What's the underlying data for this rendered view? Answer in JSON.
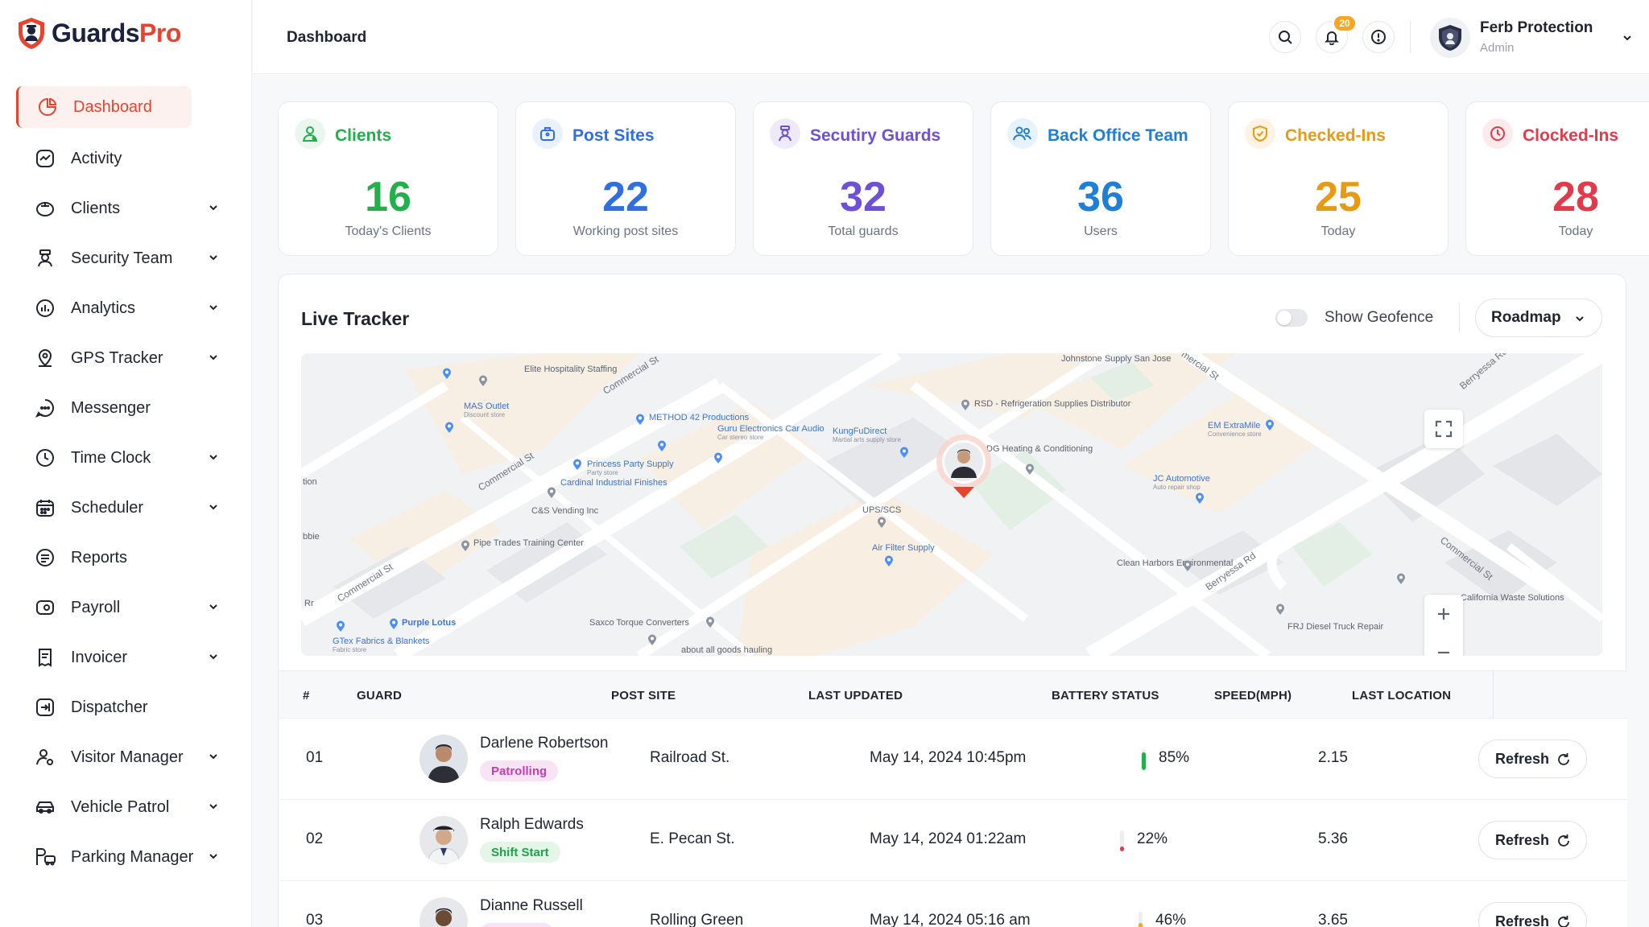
{
  "app": {
    "brand_part1": "Guards",
    "brand_part2": "Pro"
  },
  "header": {
    "title": "Dashboard",
    "notification_count": "20",
    "user_name": "Ferb Protection",
    "user_role": "Admin"
  },
  "sidebar": {
    "items": [
      {
        "label": "Dashboard",
        "icon": "dashboard-icon"
      },
      {
        "label": "Activity",
        "icon": "activity-icon"
      },
      {
        "label": "Clients",
        "icon": "clients-icon"
      },
      {
        "label": "Security Team",
        "icon": "security-team-icon"
      },
      {
        "label": "Analytics",
        "icon": "analytics-icon"
      },
      {
        "label": "GPS Tracker",
        "icon": "gps-tracker-icon"
      },
      {
        "label": "Messenger",
        "icon": "messenger-icon"
      },
      {
        "label": "Time Clock",
        "icon": "time-clock-icon"
      },
      {
        "label": "Scheduler",
        "icon": "scheduler-icon"
      },
      {
        "label": "Reports",
        "icon": "reports-icon"
      },
      {
        "label": "Payroll",
        "icon": "payroll-icon"
      },
      {
        "label": "Invoicer",
        "icon": "invoicer-icon"
      },
      {
        "label": "Dispatcher",
        "icon": "dispatcher-icon"
      },
      {
        "label": "Visitor Manager",
        "icon": "visitor-manager-icon"
      },
      {
        "label": "Vehicle Patrol",
        "icon": "vehicle-patrol-icon"
      },
      {
        "label": "Parking Manager",
        "icon": "parking-manager-icon"
      }
    ]
  },
  "stats": [
    {
      "title": "Clients",
      "value": "16",
      "subtitle": "Today's Clients",
      "color": "#22b04b",
      "bg": "#e9f7ee"
    },
    {
      "title": "Post Sites",
      "value": "22",
      "subtitle": "Working post sites",
      "color": "#2f6fe0",
      "bg": "#eaf1fd"
    },
    {
      "title": "Secutiry Guards",
      "value": "32",
      "subtitle": "Total guards",
      "color": "#6f4fd8",
      "bg": "#efeafb"
    },
    {
      "title": "Back Office Team",
      "value": "36",
      "subtitle": "Users",
      "color": "#1e7fd6",
      "bg": "#e7f2fc"
    },
    {
      "title": "Checked-Ins",
      "value": "25",
      "subtitle": "Today",
      "color": "#e79a14",
      "bg": "#fdf3e2"
    },
    {
      "title": "Clocked-Ins",
      "value": "28",
      "subtitle": "Today",
      "color": "#e23a4a",
      "bg": "#fdeaec"
    }
  ],
  "tracker": {
    "title": "Live Tracker",
    "geofence_label": "Show Geofence",
    "geofence_on": false,
    "map_type": "Roadmap"
  },
  "map": {
    "places": [
      "Elite Hospitality Staffing",
      "MAS Outlet",
      "Discount store",
      "METHOD 42 Productions",
      "Guru Electronics Car Audio",
      "Car stereo store",
      "Princess Party Supply",
      "Party store",
      "Cardinal Industrial Finishes",
      "C&S Vending Inc",
      "Pipe Trades Training Center",
      "Purple Lotus",
      "GTex Fabrics & Blankets",
      "Fabric store",
      "Saxco Torque Converters",
      "about all goods hauling",
      "KungFuDirect",
      "Martial arts supply store",
      "RSD - Refrigeration Supplies Distributor",
      "DG Heating & Conditioning",
      "UPS/SCS",
      "Air Filter Supply",
      "Johnstone Supply San Jose",
      "EM ExtraMile",
      "Convenience store",
      "JC Automotive",
      "Auto repair shop",
      "Clean Harbors Environmental",
      "FRJ Diesel Truck Repair",
      "California Waste Solutions",
      "tion",
      "bbie",
      "Rr"
    ],
    "roads": [
      "Commercial St",
      "Commercial St",
      "Commercial St",
      "Commercial St",
      "Berryessa Rd",
      "Berryessa Rd",
      "mercial St"
    ]
  },
  "table": {
    "columns": [
      "#",
      "GUARD",
      "POST SITE",
      "LAST UPDATED",
      "BATTERY STATUS",
      "SPEED(MPH)",
      "LAST LOCATION"
    ],
    "rows": [
      {
        "num": "01",
        "name": "Darlene Robertson",
        "status": "Patrolling",
        "post_site": "Railroad St.",
        "updated": "May 14, 2024 10:45pm",
        "battery": "85%",
        "battery_pct": 85,
        "battery_color": "#22b04b",
        "speed": "2.15",
        "action": "Refresh"
      },
      {
        "num": "02",
        "name": "Ralph Edwards",
        "status": "Shift Start",
        "post_site": "E. Pecan St.",
        "updated": "May 14, 2024 01:22am",
        "battery": "22%",
        "battery_pct": 22,
        "battery_color": "#e23a4a",
        "speed": "5.36",
        "action": "Refresh"
      },
      {
        "num": "03",
        "name": "Dianne Russell",
        "status": "",
        "post_site": "Rolling Green",
        "updated": "May 14, 2024 05:16 am",
        "battery": "46%",
        "battery_pct": 46,
        "battery_color": "#f5a623",
        "speed": "3.65",
        "action": "Refresh"
      }
    ]
  }
}
